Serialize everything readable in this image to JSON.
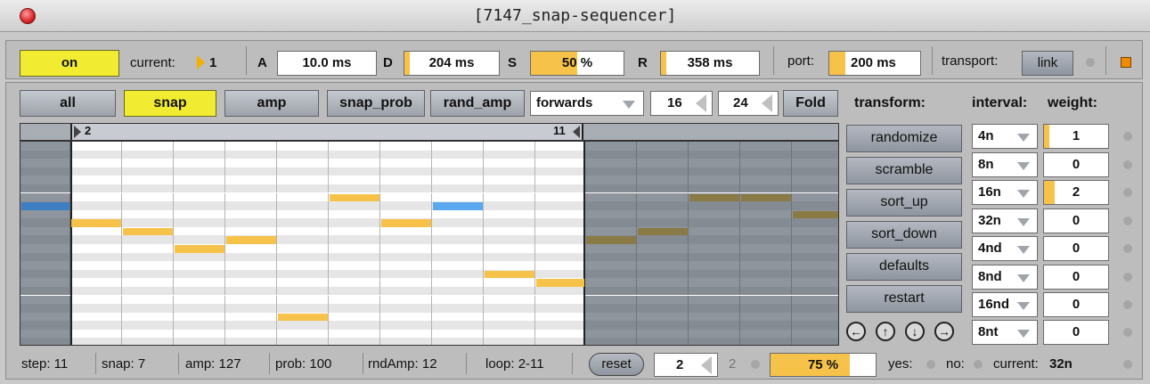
{
  "window": {
    "title": "[7147_snap-sequencer]"
  },
  "toolbar": {
    "on_label": "on",
    "current_label": "current:",
    "current_value": "1",
    "a_label": "A",
    "a_value": "10.0 ms",
    "d_label": "D",
    "d_value": "204 ms",
    "s_label": "S",
    "s_value": "50 %",
    "s_level": 0.5,
    "r_label": "R",
    "r_value": "358 ms",
    "port_label": "port:",
    "port_value": "200 ms",
    "transport_label": "transport:",
    "link_label": "link"
  },
  "modes": {
    "all": "all",
    "snap": "snap",
    "amp": "amp",
    "snap_prob": "snap_prob",
    "rand_amp": "rand_amp",
    "direction": "forwards",
    "num_a": "16",
    "num_b": "24",
    "fold": "Fold"
  },
  "loop": {
    "start_label": "2",
    "end_label": "11"
  },
  "transform": {
    "title": "transform:",
    "buttons": [
      "randomize",
      "scramble",
      "sort_up",
      "sort_down",
      "defaults",
      "restart"
    ]
  },
  "intervals": {
    "interval_title": "interval:",
    "weight_title": "weight:",
    "rows": [
      {
        "interval": "4n",
        "weight": "1",
        "level": 0.08
      },
      {
        "interval": "8n",
        "weight": "0",
        "level": 0
      },
      {
        "interval": "16n",
        "weight": "2",
        "level": 0.17
      },
      {
        "interval": "32n",
        "weight": "0",
        "level": 0
      },
      {
        "interval": "4nd",
        "weight": "0",
        "level": 0
      },
      {
        "interval": "8nd",
        "weight": "0",
        "level": 0
      },
      {
        "interval": "16nd",
        "weight": "0",
        "level": 0
      },
      {
        "interval": "8nt",
        "weight": "0",
        "level": 0
      }
    ]
  },
  "sequencer": {
    "columns": 16,
    "rows": 24,
    "loop_start": 2,
    "loop_end": 11,
    "steps": [
      {
        "col": 1,
        "row": 7,
        "color": "#3d7fc2"
      },
      {
        "col": 2,
        "row": 9,
        "color": "#f6c24a"
      },
      {
        "col": 3,
        "row": 10,
        "color": "#f6c24a"
      },
      {
        "col": 4,
        "row": 12,
        "color": "#f6c24a"
      },
      {
        "col": 5,
        "row": 11,
        "color": "#f6c24a"
      },
      {
        "col": 6,
        "row": 20,
        "color": "#f6c24a"
      },
      {
        "col": 7,
        "row": 6,
        "color": "#f6c24a"
      },
      {
        "col": 8,
        "row": 9,
        "color": "#f6c24a"
      },
      {
        "col": 9,
        "row": 7,
        "color": "#5aa8f0"
      },
      {
        "col": 10,
        "row": 15,
        "color": "#f6c24a"
      },
      {
        "col": 11,
        "row": 16,
        "color": "#f6c24a"
      },
      {
        "col": 12,
        "row": 11,
        "color": "#8a7a45"
      },
      {
        "col": 13,
        "row": 10,
        "color": "#8a7a45"
      },
      {
        "col": 14,
        "row": 6,
        "color": "#8a7a45"
      },
      {
        "col": 15,
        "row": 6,
        "color": "#8a7a45"
      },
      {
        "col": 16,
        "row": 8,
        "color": "#8a7a45"
      }
    ]
  },
  "status": {
    "step": "step: 11",
    "snap": "snap: 7",
    "amp": "amp: 127",
    "prob": "prob: 100",
    "rndamp": "rndAmp: 12",
    "loop": "loop: 2-11",
    "reset": "reset",
    "num_value": "2",
    "num_echo": "2",
    "percent": "75 %",
    "percent_level": 0.75,
    "yes": "yes:",
    "no": "no:",
    "current": "current:",
    "current_value": "32n"
  }
}
